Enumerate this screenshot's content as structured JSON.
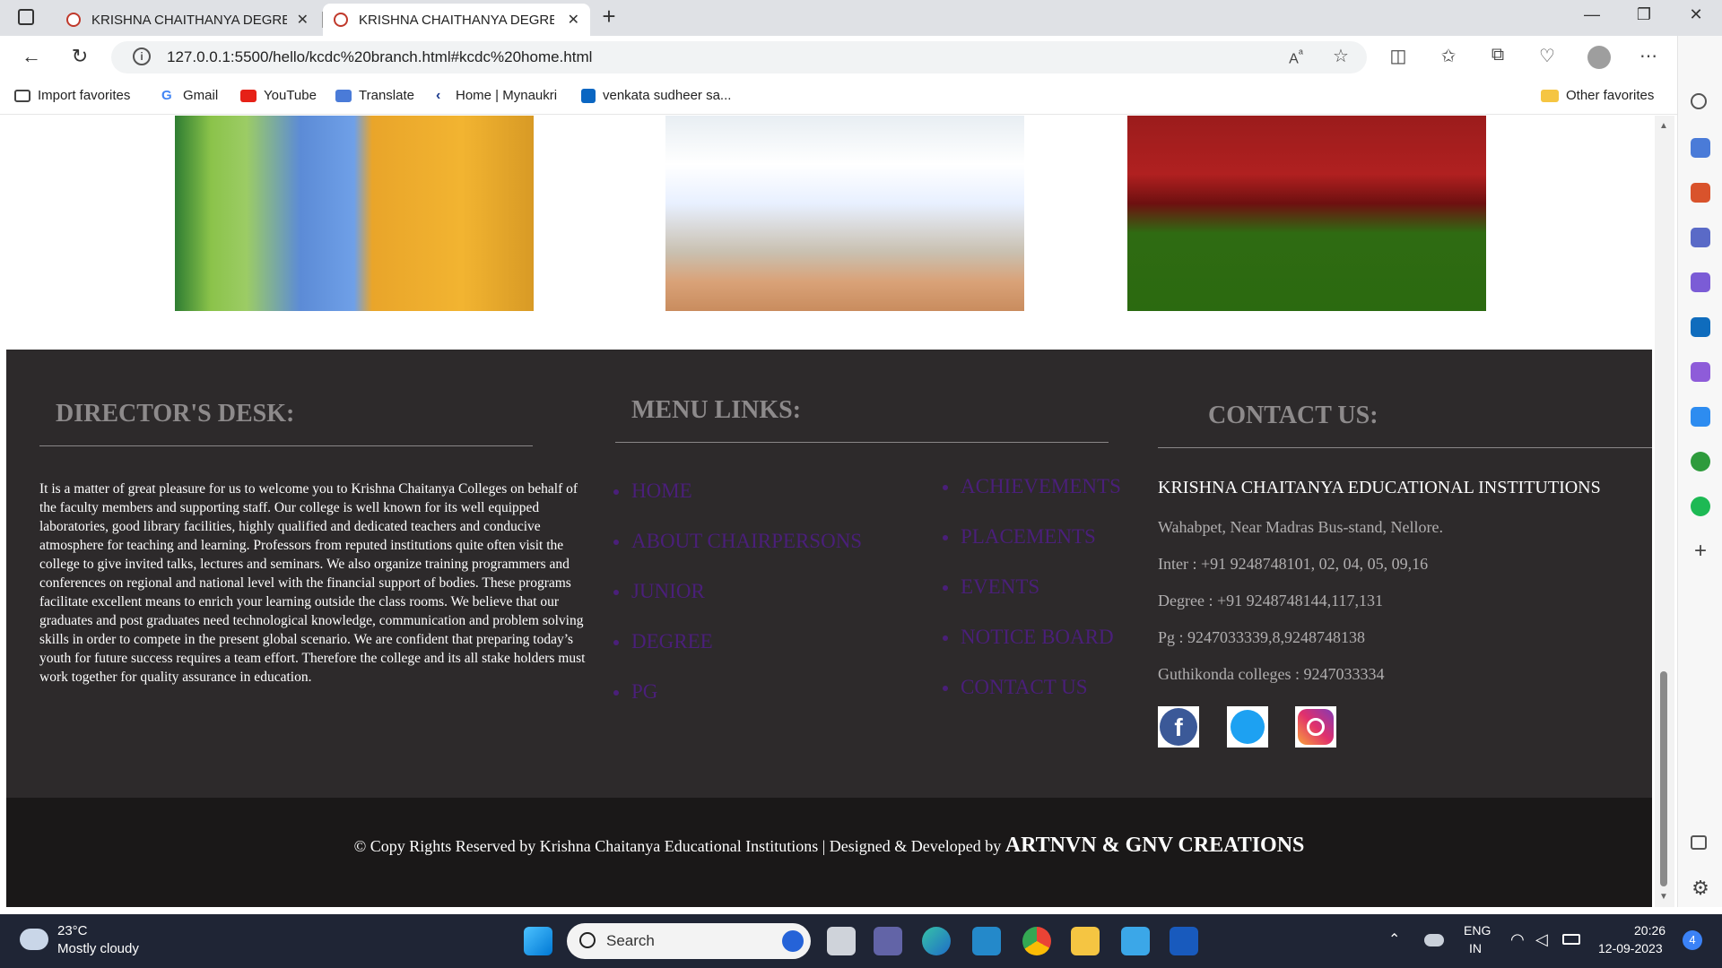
{
  "browser": {
    "tabs": [
      {
        "title": "KRISHNA CHAITHANYA DEGREE"
      },
      {
        "title": "KRISHNA CHAITHANYA DEGREE"
      }
    ],
    "url": "127.0.0.1:5500/hello/kcdc%20branch.html#kcdc%20home.html",
    "favorites": [
      "Import favorites",
      "Gmail",
      "YouTube",
      "Translate",
      "Home | Mynaukri",
      "venkata sudheer sa...",
      "Other favorites"
    ]
  },
  "footer": {
    "director": {
      "heading": "DIRECTOR'S DESK:",
      "text": "It is a matter of great pleasure for us to welcome you to Krishna Chaitanya Colleges on behalf of the faculty members and supporting staff. Our college is well known for its well equipped laboratories, good library facilities, highly qualified and dedicated teachers and conducive atmosphere for teaching and learning. Professors from reputed institutions quite often visit the college to give invited talks, lectures and seminars. We also organize training programmers and conferences on regional and national level with the financial support of bodies. These programs facilitate excellent means to enrich your learning outside the class rooms. We believe that our graduates and post graduates need technological knowledge, communication and problem solving skills in order to compete in the present global scenario. We are confident that preparing today’s youth for future success requires a team effort. Therefore the college and its all stake holders must work together for quality assurance in education."
    },
    "menu": {
      "heading": "MENU LINKS:",
      "col1": [
        "HOME",
        "ABOUT CHAIRPERSONS",
        "JUNIOR",
        "DEGREE",
        "PG"
      ],
      "col2": [
        "ACHIEVEMENTS",
        "PLACEMENTS",
        "EVENTS",
        "NOTICE BOARD",
        "CONTACT US"
      ]
    },
    "contact": {
      "heading": "CONTACT US:",
      "org": "KRISHNA CHAITANYA EDUCATIONAL INSTITUTIONS",
      "lines": [
        "Wahabpet, Near Madras Bus-stand, Nellore.",
        "Inter : +91 9248748101, 02, 04, 05, 09,16",
        "Degree : +91 9248748144,117,131",
        "Pg : 9247033339,8,9248748138",
        "Guthikonda colleges : 9247033334"
      ]
    },
    "copyright": "© Copy Rights Reserved by Krishna Chaitanya Educational Institutions | Designed & Developed by",
    "creator": "ARTNVN & GNV CREATIONS"
  },
  "taskbar": {
    "weather_temp": "23°C",
    "weather_desc": "Mostly cloudy",
    "search_placeholder": "Search",
    "lang1": "ENG",
    "lang2": "IN",
    "time": "20:26",
    "date": "12-09-2023",
    "notif_count": "4"
  },
  "colors": {
    "footer_bg": "#2d2a2b",
    "copy_bg": "#1a1818",
    "menu_link": "#4a1f7a",
    "heading": "#8d8a8b"
  }
}
